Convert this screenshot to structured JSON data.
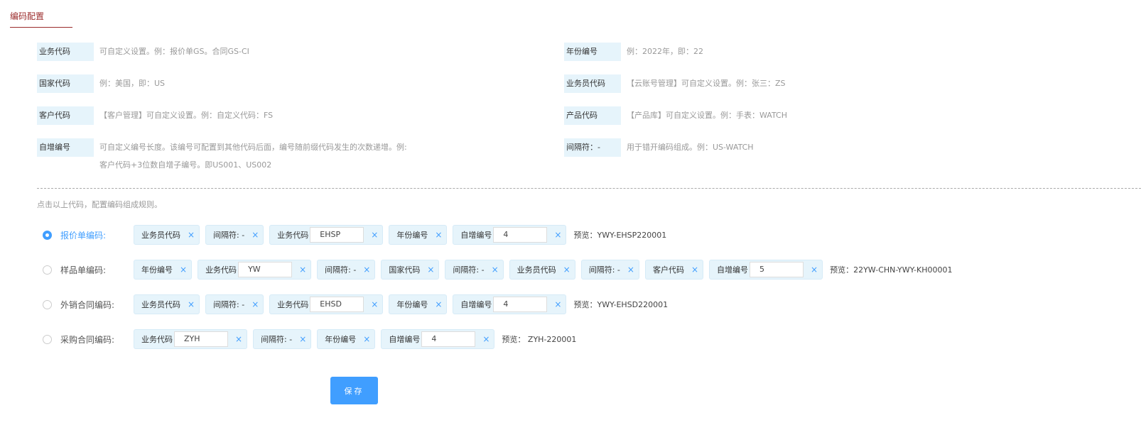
{
  "tab": {
    "label": "编码配置"
  },
  "legend": [
    {
      "key": "业务代码",
      "desc": "可自定义设置。例：报价单GS。合同GS-CI",
      "desc2": ""
    },
    {
      "key": "年份编号",
      "desc": "例：2022年，即：22",
      "desc2": ""
    },
    {
      "key": "国家代码",
      "desc": "例：美国，即：US",
      "desc2": ""
    },
    {
      "key": "业务员代码",
      "desc": "【云账号管理】可自定义设置。例：张三：ZS",
      "desc2": ""
    },
    {
      "key": "客户代码",
      "desc": "【客户管理】可自定义设置。例：自定义代码：FS",
      "desc2": ""
    },
    {
      "key": "产品代码",
      "desc": "【产品库】可自定义设置。例：手表：WATCH",
      "desc2": ""
    },
    {
      "key": "自增编号",
      "desc": "可自定义编号长度。该编号可配置到其他代码后面，编号随前缀代码发生的次数递增。例:",
      "desc2": "客户代码+3位数自增子编号。即US001、US002"
    },
    {
      "key": "间隔符：-",
      "desc": "用于错开编码组成。例：US-WATCH",
      "desc2": ""
    }
  ],
  "hint": "点击以上代码，配置编码组成规则。",
  "rows": [
    {
      "label": "报价单编码:",
      "selected": true,
      "chips": [
        {
          "text": "业务员代码"
        },
        {
          "text": "间隔符: -"
        },
        {
          "text": "业务代码",
          "value": "EHSP"
        },
        {
          "text": "年份编号"
        },
        {
          "text": "自增编号",
          "value": "4"
        }
      ],
      "preview": "预览：YWY-EHSP220001"
    },
    {
      "label": "样品单编码:",
      "selected": false,
      "chips": [
        {
          "text": "年份编号"
        },
        {
          "text": "业务代码",
          "value": "YW"
        },
        {
          "text": "间隔符: -"
        },
        {
          "text": "国家代码"
        },
        {
          "text": "间隔符: -"
        },
        {
          "text": "业务员代码"
        },
        {
          "text": "间隔符: -"
        },
        {
          "text": "客户代码"
        },
        {
          "text": "自增编号",
          "value": "5"
        }
      ],
      "preview": "预览：22YW-CHN-YWY-KH00001"
    },
    {
      "label": "外销合同编码:",
      "selected": false,
      "chips": [
        {
          "text": "业务员代码"
        },
        {
          "text": "间隔符: -"
        },
        {
          "text": "业务代码",
          "value": "EHSD"
        },
        {
          "text": "年份编号"
        },
        {
          "text": "自增编号",
          "value": "4"
        }
      ],
      "preview": "预览：YWY-EHSD220001"
    },
    {
      "label": "采购合同编码:",
      "selected": false,
      "chips": [
        {
          "text": "业务代码",
          "value": "ZYH"
        },
        {
          "text": "间隔符: -"
        },
        {
          "text": "年份编号"
        },
        {
          "text": "自增编号",
          "value": "4"
        }
      ],
      "preview": "预览： ZYH-220001"
    }
  ],
  "close_icon": "×",
  "save_label": "保存",
  "colors": {
    "accent": "#409eff",
    "tab": "#9b2b2b",
    "chip_bg": "#e6f4fb"
  }
}
